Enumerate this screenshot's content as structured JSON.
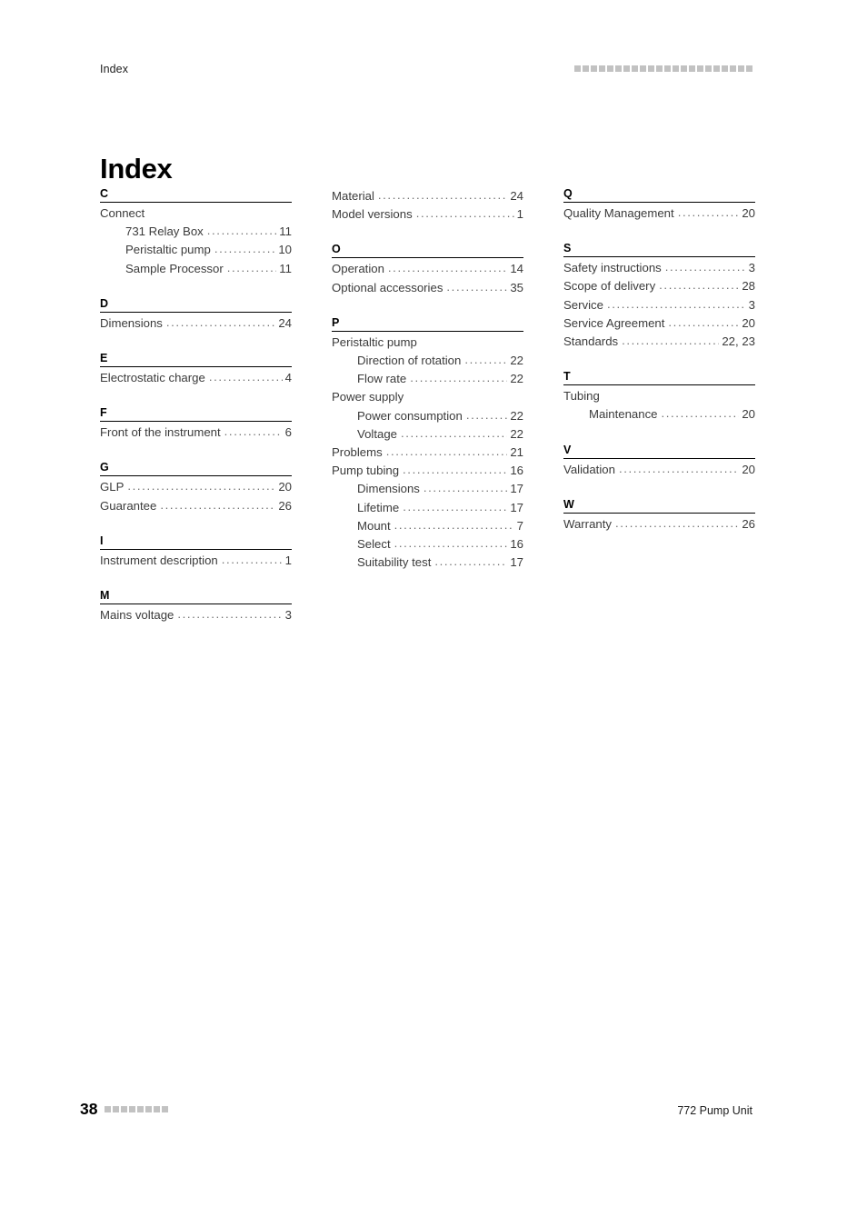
{
  "header": {
    "running_label": "Index",
    "decoration_squares": 22,
    "decoration_color": "#c2c2c2"
  },
  "page_title": "Index",
  "footer": {
    "page_number": "38",
    "decoration_squares": 8,
    "decoration_color": "#c2c2c2",
    "document_title": "772 Pump Unit"
  },
  "columns": [
    {
      "groups": [
        {
          "letter": "C",
          "entries": [
            {
              "text": "Connect",
              "page": "",
              "level": 0,
              "leader": false
            },
            {
              "text": "731 Relay Box",
              "page": "11",
              "level": 1,
              "leader": true
            },
            {
              "text": "Peristaltic pump",
              "page": "10",
              "level": 1,
              "leader": true
            },
            {
              "text": "Sample Processor",
              "page": "11",
              "level": 1,
              "leader": true
            }
          ]
        },
        {
          "letter": "D",
          "entries": [
            {
              "text": "Dimensions",
              "page": "24",
              "level": 0,
              "leader": true
            }
          ]
        },
        {
          "letter": "E",
          "entries": [
            {
              "text": "Electrostatic charge",
              "page": "4",
              "level": 0,
              "leader": true
            }
          ]
        },
        {
          "letter": "F",
          "entries": [
            {
              "text": "Front of the instrument",
              "page": "6",
              "level": 0,
              "leader": true
            }
          ]
        },
        {
          "letter": "G",
          "entries": [
            {
              "text": "GLP",
              "page": "20",
              "level": 0,
              "leader": true
            },
            {
              "text": "Guarantee",
              "page": "26",
              "level": 0,
              "leader": true
            }
          ]
        },
        {
          "letter": "I",
          "entries": [
            {
              "text": "Instrument description",
              "page": "1",
              "level": 0,
              "leader": true
            }
          ]
        },
        {
          "letter": "M",
          "entries": [
            {
              "text": "Mains voltage",
              "page": "3",
              "level": 0,
              "leader": true
            }
          ]
        }
      ]
    },
    {
      "groups": [
        {
          "letter": "",
          "entries": [
            {
              "text": "Material",
              "page": "24",
              "level": 0,
              "leader": true
            },
            {
              "text": "Model versions",
              "page": "1",
              "level": 0,
              "leader": true
            }
          ]
        },
        {
          "letter": "O",
          "entries": [
            {
              "text": "Operation",
              "page": "14",
              "level": 0,
              "leader": true
            },
            {
              "text": "Optional accessories",
              "page": "35",
              "level": 0,
              "leader": true
            }
          ]
        },
        {
          "letter": "P",
          "entries": [
            {
              "text": "Peristaltic pump",
              "page": "",
              "level": 0,
              "leader": false
            },
            {
              "text": "Direction of rotation",
              "page": "22",
              "level": 1,
              "leader": true
            },
            {
              "text": "Flow rate",
              "page": "22",
              "level": 1,
              "leader": true
            },
            {
              "text": "Power supply",
              "page": "",
              "level": 0,
              "leader": false
            },
            {
              "text": "Power consumption",
              "page": "22",
              "level": 1,
              "leader": true
            },
            {
              "text": "Voltage",
              "page": "22",
              "level": 1,
              "leader": true
            },
            {
              "text": "Problems",
              "page": "21",
              "level": 0,
              "leader": true
            },
            {
              "text": "Pump tubing",
              "page": "16",
              "level": 0,
              "leader": true
            },
            {
              "text": "Dimensions",
              "page": "17",
              "level": 1,
              "leader": true
            },
            {
              "text": "Lifetime",
              "page": "17",
              "level": 1,
              "leader": true
            },
            {
              "text": "Mount",
              "page": "7",
              "level": 1,
              "leader": true
            },
            {
              "text": "Select",
              "page": "16",
              "level": 1,
              "leader": true
            },
            {
              "text": "Suitability test",
              "page": "17",
              "level": 1,
              "leader": true
            }
          ]
        }
      ]
    },
    {
      "groups": [
        {
          "letter": "Q",
          "entries": [
            {
              "text": "Quality Management",
              "page": "20",
              "level": 0,
              "leader": true
            }
          ]
        },
        {
          "letter": "S",
          "entries": [
            {
              "text": "Safety instructions",
              "page": "3",
              "level": 0,
              "leader": true
            },
            {
              "text": "Scope of delivery",
              "page": "28",
              "level": 0,
              "leader": true
            },
            {
              "text": "Service",
              "page": "3",
              "level": 0,
              "leader": true
            },
            {
              "text": "Service Agreement",
              "page": "20",
              "level": 0,
              "leader": true
            },
            {
              "text": "Standards",
              "page": "22, 23",
              "level": 0,
              "leader": true
            }
          ]
        },
        {
          "letter": "T",
          "entries": [
            {
              "text": "Tubing",
              "page": "",
              "level": 0,
              "leader": false
            },
            {
              "text": "Maintenance",
              "page": "20",
              "level": 1,
              "leader": true
            }
          ]
        },
        {
          "letter": "V",
          "entries": [
            {
              "text": "Validation",
              "page": "20",
              "level": 0,
              "leader": true
            }
          ]
        },
        {
          "letter": "W",
          "entries": [
            {
              "text": "Warranty",
              "page": "26",
              "level": 0,
              "leader": true
            }
          ]
        }
      ]
    }
  ]
}
